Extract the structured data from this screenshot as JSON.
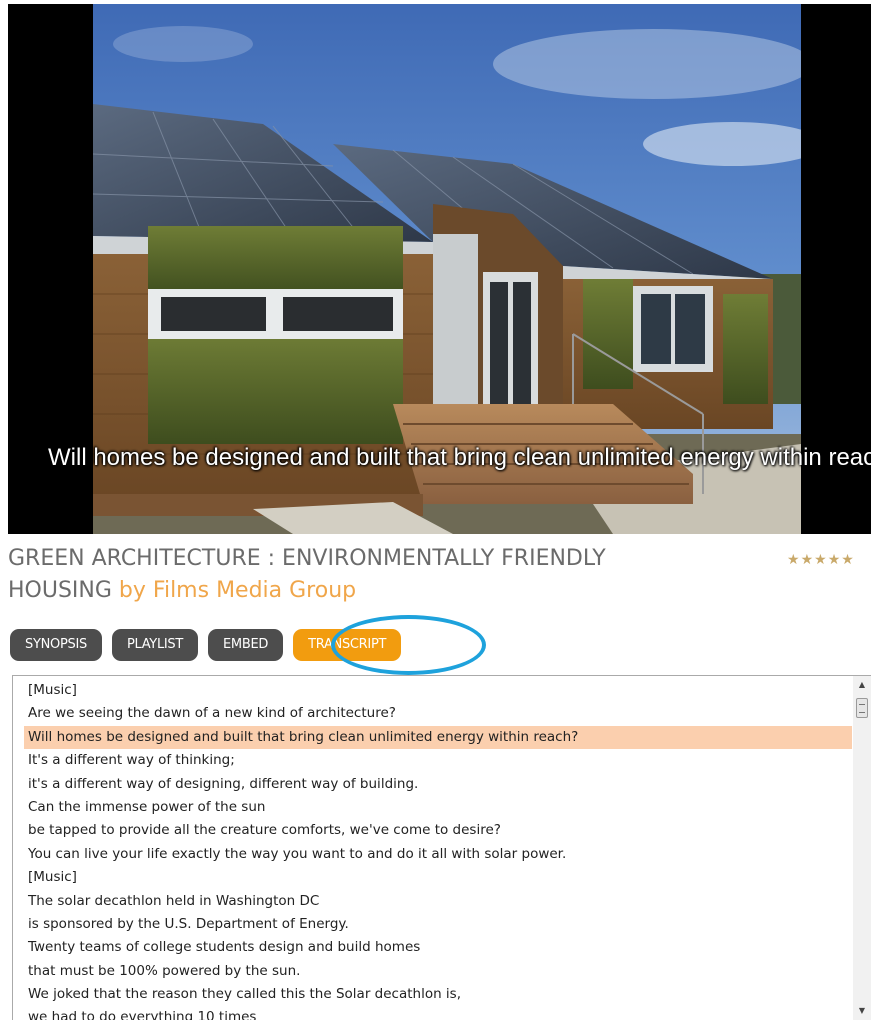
{
  "video": {
    "caption": "Will homes be designed and built that bring clean unlimited energy within reach?"
  },
  "title": {
    "main": "GREEN ARCHITECTURE : ENVIRONMENTALLY FRIENDLY HOUSING",
    "by": "by Films Media Group"
  },
  "rating": {
    "stars": 5,
    "star_glyph": "★",
    "color": "#c9a96a"
  },
  "tabs": [
    {
      "label": "SYNOPSIS"
    },
    {
      "label": "PLAYLIST"
    },
    {
      "label": "EMBED"
    },
    {
      "label": "TRANSCRIPT",
      "active": true
    }
  ],
  "colors": {
    "accent": "#f29c0f",
    "ring": "#1ea2dc",
    "current_line": "#fbcfae",
    "tab_bg": "#4d4d4d",
    "by_text": "#f0a64a"
  },
  "transcript": {
    "current_index": 2,
    "lines": [
      "[Music]",
      "Are we seeing the dawn of a new kind of architecture?",
      "Will homes be designed and built that bring clean unlimited energy within reach?",
      "It's a different way of thinking;",
      "it's a different way of designing, different way of building.",
      "Can the immense power of the sun",
      "be tapped to provide all the creature comforts, we've come to desire?",
      "You can live your life exactly the way you want to and do it all with solar power.",
      "[Music]",
      "The solar decathlon held in Washington DC",
      "is sponsored by the U.S. Department of Energy.",
      "Twenty teams of college students design and build homes",
      "that must be 100% powered by the sun.",
      "We joked that the reason they called this the Solar decathlon is,",
      "we had to do everything 10 times"
    ]
  },
  "scrollbar": {
    "up_icon": "▲",
    "down_icon": "▼"
  }
}
